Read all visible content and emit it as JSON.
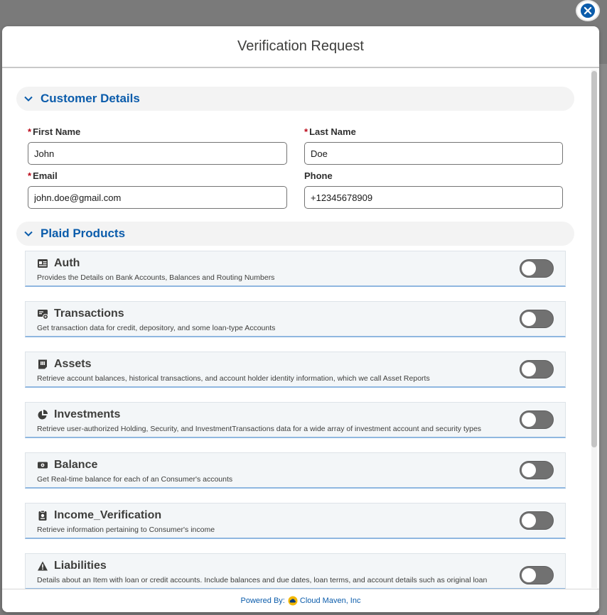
{
  "modal": {
    "title": "Verification Request",
    "close_icon": "close-icon"
  },
  "customer_section": {
    "title": "Customer Details",
    "fields": {
      "first_name": {
        "label": "First Name",
        "value": "John",
        "required": true
      },
      "last_name": {
        "label": "Last Name",
        "value": "Doe",
        "required": true
      },
      "email": {
        "label": "Email",
        "value": "john.doe@gmail.com",
        "required": true
      },
      "phone": {
        "label": "Phone",
        "value": "+12345678909",
        "required": false
      }
    },
    "required_marker": "*"
  },
  "products_section": {
    "title": "Plaid Products",
    "items": [
      {
        "name": "Auth",
        "icon": "id-card-icon",
        "description": "Provides the Details on Bank Accounts, Balances and Routing Numbers",
        "enabled": false
      },
      {
        "name": "Transactions",
        "icon": "transactions-icon",
        "description": "Get transaction data for credit, depository, and some loan-type Accounts",
        "enabled": false
      },
      {
        "name": "Assets",
        "icon": "assets-icon",
        "description": "Retrieve account balances, historical transactions, and account holder identity information, which we call Asset Reports",
        "enabled": false
      },
      {
        "name": "Investments",
        "icon": "pie-chart-icon",
        "description": "Retrieve user-authorized Holding, Security, and InvestmentTransactions data for a wide array of investment account and security types",
        "enabled": false
      },
      {
        "name": "Balance",
        "icon": "money-icon",
        "description": "Get Real-time balance for each of an Consumer's accounts",
        "enabled": false
      },
      {
        "name": "Income_Verification",
        "icon": "income-icon",
        "description": "Retrieve information pertaining to Consumer's income",
        "enabled": false
      },
      {
        "name": "Liabilities",
        "icon": "warning-icon",
        "description": "Details about an Item with loan or credit accounts. Include balances and due dates, loan terms, and account details such as original loan",
        "enabled": false
      }
    ]
  },
  "footer": {
    "powered_by_label": "Powered By:",
    "company": "Cloud Maven, Inc"
  },
  "colors": {
    "accent": "#0b5cab",
    "required": "#ba0517",
    "toggle_off": "#717171",
    "overlay": "#7a7a7a"
  }
}
